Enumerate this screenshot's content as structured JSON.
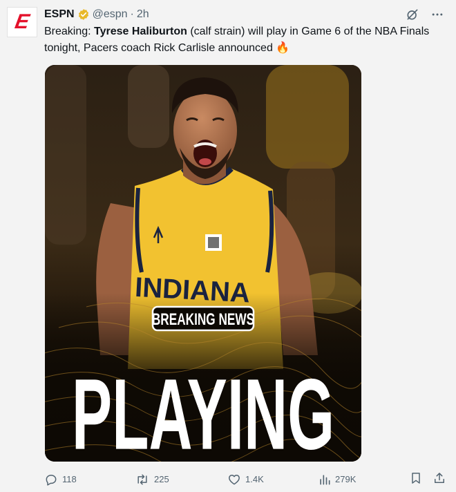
{
  "post": {
    "author_name": "ESPN",
    "handle": "@espn",
    "separator": "·",
    "time": "2h",
    "text_prefix": "Breaking: ",
    "text_bold": "Tyrese Haliburton",
    "text_rest": " (calf strain) will play in Game 6 of the NBA Finals tonight, Pacers coach Rick Carlisle announced ",
    "text_emoji": "🔥"
  },
  "avatar": {
    "logo_text": "E"
  },
  "media": {
    "jersey_text": "INDIANA",
    "badge_text": "BREAKING NEWS",
    "headline": "PLAYING"
  },
  "actions": {
    "replies": "118",
    "reposts": "225",
    "likes": "1.4K",
    "views": "279K"
  },
  "colors": {
    "espn_red": "#e4112b",
    "verified_gold": "#e8b829",
    "text_secondary": "#536471",
    "jersey_gold": "#f2c230",
    "jersey_navy": "#1a2340"
  },
  "icons": [
    "verified-badge-icon",
    "grok-icon",
    "more-icon",
    "reply-icon",
    "repost-icon",
    "like-icon",
    "views-icon",
    "bookmark-icon",
    "share-icon"
  ]
}
